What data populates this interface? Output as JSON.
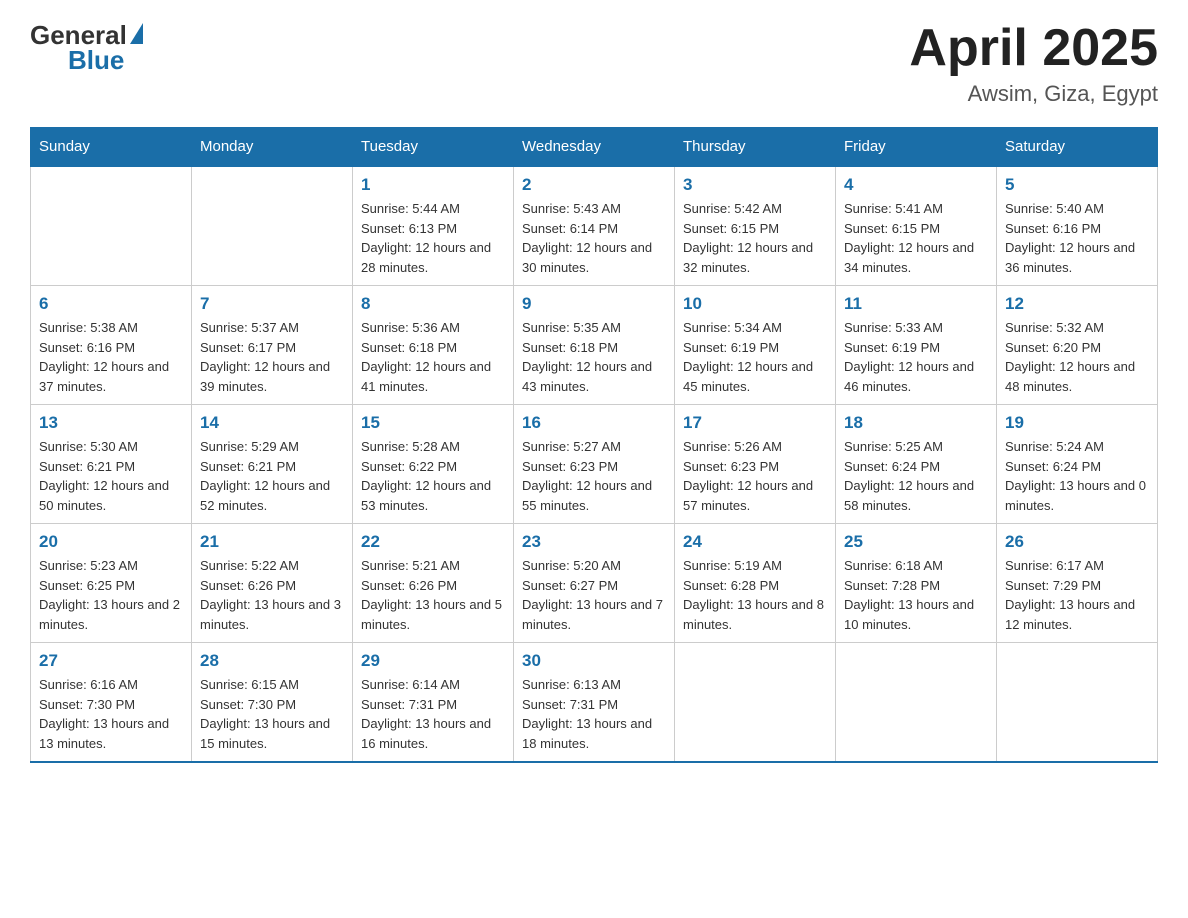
{
  "header": {
    "title": "April 2025",
    "subtitle": "Awsim, Giza, Egypt",
    "logo_general": "General",
    "logo_blue": "Blue"
  },
  "weekdays": [
    "Sunday",
    "Monday",
    "Tuesday",
    "Wednesday",
    "Thursday",
    "Friday",
    "Saturday"
  ],
  "weeks": [
    [
      {
        "day": "",
        "sunrise": "",
        "sunset": "",
        "daylight": ""
      },
      {
        "day": "",
        "sunrise": "",
        "sunset": "",
        "daylight": ""
      },
      {
        "day": "1",
        "sunrise": "Sunrise: 5:44 AM",
        "sunset": "Sunset: 6:13 PM",
        "daylight": "Daylight: 12 hours and 28 minutes."
      },
      {
        "day": "2",
        "sunrise": "Sunrise: 5:43 AM",
        "sunset": "Sunset: 6:14 PM",
        "daylight": "Daylight: 12 hours and 30 minutes."
      },
      {
        "day": "3",
        "sunrise": "Sunrise: 5:42 AM",
        "sunset": "Sunset: 6:15 PM",
        "daylight": "Daylight: 12 hours and 32 minutes."
      },
      {
        "day": "4",
        "sunrise": "Sunrise: 5:41 AM",
        "sunset": "Sunset: 6:15 PM",
        "daylight": "Daylight: 12 hours and 34 minutes."
      },
      {
        "day": "5",
        "sunrise": "Sunrise: 5:40 AM",
        "sunset": "Sunset: 6:16 PM",
        "daylight": "Daylight: 12 hours and 36 minutes."
      }
    ],
    [
      {
        "day": "6",
        "sunrise": "Sunrise: 5:38 AM",
        "sunset": "Sunset: 6:16 PM",
        "daylight": "Daylight: 12 hours and 37 minutes."
      },
      {
        "day": "7",
        "sunrise": "Sunrise: 5:37 AM",
        "sunset": "Sunset: 6:17 PM",
        "daylight": "Daylight: 12 hours and 39 minutes."
      },
      {
        "day": "8",
        "sunrise": "Sunrise: 5:36 AM",
        "sunset": "Sunset: 6:18 PM",
        "daylight": "Daylight: 12 hours and 41 minutes."
      },
      {
        "day": "9",
        "sunrise": "Sunrise: 5:35 AM",
        "sunset": "Sunset: 6:18 PM",
        "daylight": "Daylight: 12 hours and 43 minutes."
      },
      {
        "day": "10",
        "sunrise": "Sunrise: 5:34 AM",
        "sunset": "Sunset: 6:19 PM",
        "daylight": "Daylight: 12 hours and 45 minutes."
      },
      {
        "day": "11",
        "sunrise": "Sunrise: 5:33 AM",
        "sunset": "Sunset: 6:19 PM",
        "daylight": "Daylight: 12 hours and 46 minutes."
      },
      {
        "day": "12",
        "sunrise": "Sunrise: 5:32 AM",
        "sunset": "Sunset: 6:20 PM",
        "daylight": "Daylight: 12 hours and 48 minutes."
      }
    ],
    [
      {
        "day": "13",
        "sunrise": "Sunrise: 5:30 AM",
        "sunset": "Sunset: 6:21 PM",
        "daylight": "Daylight: 12 hours and 50 minutes."
      },
      {
        "day": "14",
        "sunrise": "Sunrise: 5:29 AM",
        "sunset": "Sunset: 6:21 PM",
        "daylight": "Daylight: 12 hours and 52 minutes."
      },
      {
        "day": "15",
        "sunrise": "Sunrise: 5:28 AM",
        "sunset": "Sunset: 6:22 PM",
        "daylight": "Daylight: 12 hours and 53 minutes."
      },
      {
        "day": "16",
        "sunrise": "Sunrise: 5:27 AM",
        "sunset": "Sunset: 6:23 PM",
        "daylight": "Daylight: 12 hours and 55 minutes."
      },
      {
        "day": "17",
        "sunrise": "Sunrise: 5:26 AM",
        "sunset": "Sunset: 6:23 PM",
        "daylight": "Daylight: 12 hours and 57 minutes."
      },
      {
        "day": "18",
        "sunrise": "Sunrise: 5:25 AM",
        "sunset": "Sunset: 6:24 PM",
        "daylight": "Daylight: 12 hours and 58 minutes."
      },
      {
        "day": "19",
        "sunrise": "Sunrise: 5:24 AM",
        "sunset": "Sunset: 6:24 PM",
        "daylight": "Daylight: 13 hours and 0 minutes."
      }
    ],
    [
      {
        "day": "20",
        "sunrise": "Sunrise: 5:23 AM",
        "sunset": "Sunset: 6:25 PM",
        "daylight": "Daylight: 13 hours and 2 minutes."
      },
      {
        "day": "21",
        "sunrise": "Sunrise: 5:22 AM",
        "sunset": "Sunset: 6:26 PM",
        "daylight": "Daylight: 13 hours and 3 minutes."
      },
      {
        "day": "22",
        "sunrise": "Sunrise: 5:21 AM",
        "sunset": "Sunset: 6:26 PM",
        "daylight": "Daylight: 13 hours and 5 minutes."
      },
      {
        "day": "23",
        "sunrise": "Sunrise: 5:20 AM",
        "sunset": "Sunset: 6:27 PM",
        "daylight": "Daylight: 13 hours and 7 minutes."
      },
      {
        "day": "24",
        "sunrise": "Sunrise: 5:19 AM",
        "sunset": "Sunset: 6:28 PM",
        "daylight": "Daylight: 13 hours and 8 minutes."
      },
      {
        "day": "25",
        "sunrise": "Sunrise: 6:18 AM",
        "sunset": "Sunset: 7:28 PM",
        "daylight": "Daylight: 13 hours and 10 minutes."
      },
      {
        "day": "26",
        "sunrise": "Sunrise: 6:17 AM",
        "sunset": "Sunset: 7:29 PM",
        "daylight": "Daylight: 13 hours and 12 minutes."
      }
    ],
    [
      {
        "day": "27",
        "sunrise": "Sunrise: 6:16 AM",
        "sunset": "Sunset: 7:30 PM",
        "daylight": "Daylight: 13 hours and 13 minutes."
      },
      {
        "day": "28",
        "sunrise": "Sunrise: 6:15 AM",
        "sunset": "Sunset: 7:30 PM",
        "daylight": "Daylight: 13 hours and 15 minutes."
      },
      {
        "day": "29",
        "sunrise": "Sunrise: 6:14 AM",
        "sunset": "Sunset: 7:31 PM",
        "daylight": "Daylight: 13 hours and 16 minutes."
      },
      {
        "day": "30",
        "sunrise": "Sunrise: 6:13 AM",
        "sunset": "Sunset: 7:31 PM",
        "daylight": "Daylight: 13 hours and 18 minutes."
      },
      {
        "day": "",
        "sunrise": "",
        "sunset": "",
        "daylight": ""
      },
      {
        "day": "",
        "sunrise": "",
        "sunset": "",
        "daylight": ""
      },
      {
        "day": "",
        "sunrise": "",
        "sunset": "",
        "daylight": ""
      }
    ]
  ]
}
